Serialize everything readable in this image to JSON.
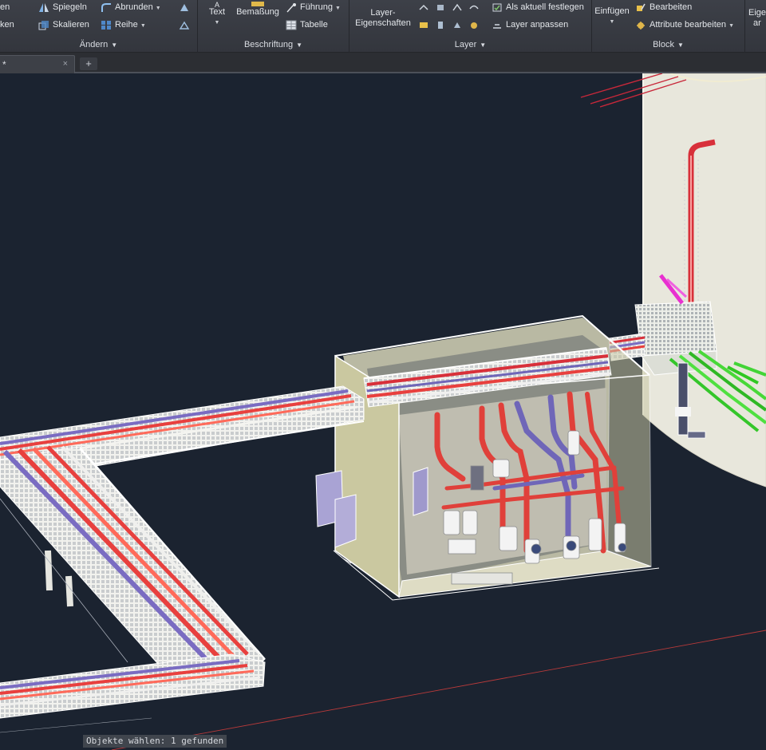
{
  "ribbon": {
    "panels": {
      "aendern": {
        "title": "Ändern",
        "items": {
          "cut_top": "en",
          "cut_bottom": "ken",
          "spiegeln": "Spiegeln",
          "skalieren": "Skalieren",
          "abrunden": "Abrunden",
          "reihe": "Reihe"
        }
      },
      "beschriftung": {
        "title": "Beschriftung",
        "items": {
          "text": "Text",
          "bemassung": "Bemaßung",
          "fuehrung": "Führung",
          "tabelle": "Tabelle"
        }
      },
      "layer": {
        "title": "Layer",
        "items": {
          "layer_eigenschaften_1": "Layer-",
          "layer_eigenschaften_2": "Eigenschaften",
          "als_aktuell": "Als aktuell festlegen",
          "layer_anpassen": "Layer anpassen"
        }
      },
      "block": {
        "title": "Block",
        "items": {
          "einfuegen": "Einfügen",
          "bearbeiten": "Bearbeiten",
          "attribute_bearbeiten": "Attribute bearbeiten"
        }
      },
      "eigen": {
        "line1": "Eige",
        "line2": "ar"
      }
    }
  },
  "tabs": {
    "document_tab": "*",
    "close_glyph": "×",
    "new_tab_glyph": "+"
  },
  "status": {
    "command_line": "Objekte wählen: 1 gefunden"
  },
  "colors": {
    "viewport_bg": "#1b2330",
    "ribbon_bg": "#3a3d44",
    "pipe_red": "#e8403e",
    "pipe_purple": "#7a6cc2",
    "pipe_green": "#3fd12f",
    "cabinet_wall": "#c9c7a0",
    "tank": "#e9e8dc"
  }
}
